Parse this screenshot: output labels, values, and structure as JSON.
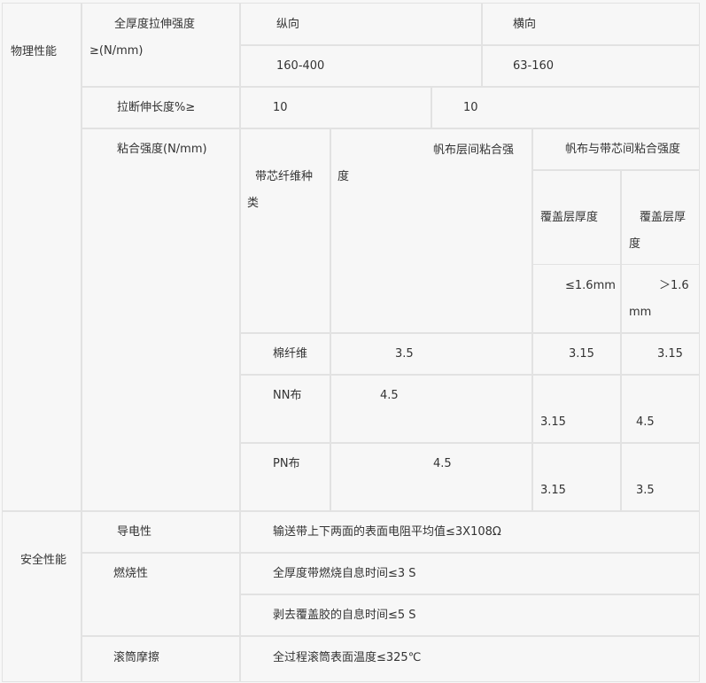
{
  "physical": {
    "label": "物理性能",
    "tensile": {
      "label_line1": "全厚度拉伸强度",
      "label_line2": "≥(N/mm)",
      "header_long": "纵向",
      "header_trans": "横向",
      "value_long": "160-400",
      "value_trans": "63-160"
    },
    "elongation": {
      "label": "拉断伸长度%≥",
      "value_1": "10",
      "value_2": "10"
    },
    "adhesion": {
      "label": "粘合强度(N/mm)",
      "core_type_line1": "带芯纤维种",
      "core_type_line2": "类",
      "between_plies_line1": "帆布层间粘合强",
      "between_plies_line2": "度",
      "cover_header": "帆布与带芯间粘合强度",
      "cover_a_line1": "覆盖层厚度",
      "cover_a_line2": "≤1.6mm",
      "cover_b_line1": "覆盖层厚",
      "cover_b_line2": "度",
      "cover_b_line3": "＞1.6",
      "cover_b_line4": "mm",
      "rows": [
        {
          "type": "棉纤维",
          "plies": "3.5",
          "cover_a": "3.15",
          "cover_b": "3.15"
        },
        {
          "type": "NN布",
          "plies": "4.5",
          "cover_a": "3.15",
          "cover_b": "4.5"
        },
        {
          "type": "PN布",
          "plies": "4.5",
          "cover_a": "3.15",
          "cover_b": "3.5"
        }
      ]
    }
  },
  "safety": {
    "label": "安全性能",
    "conductivity": {
      "label": "导电性",
      "value": "输送带上下两面的表面电阻平均值≤3X108Ω"
    },
    "flammability": {
      "label": "燃烧性",
      "value_1": "全厚度带燃烧自息时间≤3 S",
      "value_2": "剥去覆盖胶的自息时间≤5 S"
    },
    "drum_friction": {
      "label": "滚筒摩擦",
      "value": "全过程滚筒表面温度≤325℃"
    }
  }
}
